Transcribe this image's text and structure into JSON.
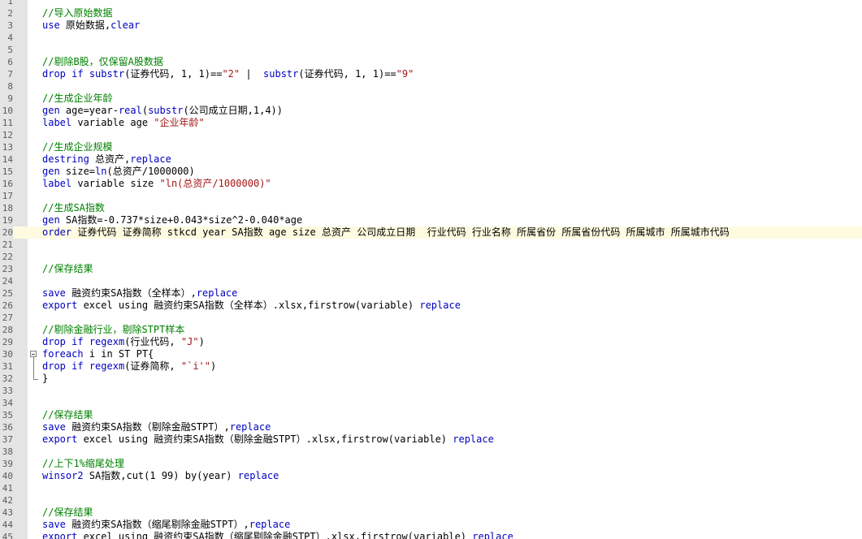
{
  "editor": {
    "colors": {
      "keyword": "#0000c0",
      "comment": "#008000",
      "string": "#a31515",
      "text": "#000000",
      "current_line": "#fffbe0"
    },
    "lines": [
      {
        "n": "1",
        "seg": []
      },
      {
        "n": "2",
        "seg": [
          {
            "c": "cm",
            "t": "//导入原始数据"
          }
        ]
      },
      {
        "n": "3",
        "seg": [
          {
            "c": "kw",
            "t": "use"
          },
          {
            "c": "",
            "t": " 原始数据,"
          },
          {
            "c": "kw",
            "t": "clear"
          }
        ]
      },
      {
        "n": "4",
        "seg": []
      },
      {
        "n": "5",
        "seg": []
      },
      {
        "n": "6",
        "seg": [
          {
            "c": "cm",
            "t": "//剔除B股，仅保留A股数据"
          }
        ]
      },
      {
        "n": "7",
        "seg": [
          {
            "c": "kw",
            "t": "drop"
          },
          {
            "c": "",
            "t": " "
          },
          {
            "c": "kw",
            "t": "if"
          },
          {
            "c": "",
            "t": " "
          },
          {
            "c": "fn",
            "t": "substr"
          },
          {
            "c": "",
            "t": "(证券代码, 1, 1)=="
          },
          {
            "c": "str",
            "t": "\"2\""
          },
          {
            "c": "",
            "t": " |  "
          },
          {
            "c": "fn",
            "t": "substr"
          },
          {
            "c": "",
            "t": "(证券代码, 1, 1)=="
          },
          {
            "c": "str",
            "t": "\"9\""
          }
        ]
      },
      {
        "n": "8",
        "seg": []
      },
      {
        "n": "9",
        "seg": [
          {
            "c": "cm",
            "t": "//生成企业年龄"
          }
        ]
      },
      {
        "n": "10",
        "seg": [
          {
            "c": "kw",
            "t": "gen"
          },
          {
            "c": "",
            "t": " age=year-"
          },
          {
            "c": "fn",
            "t": "real"
          },
          {
            "c": "",
            "t": "("
          },
          {
            "c": "fn",
            "t": "substr"
          },
          {
            "c": "",
            "t": "(公司成立日期,1,4))"
          }
        ]
      },
      {
        "n": "11",
        "seg": [
          {
            "c": "kw",
            "t": "label"
          },
          {
            "c": "",
            "t": " variable age "
          },
          {
            "c": "str",
            "t": "\"企业年龄\""
          }
        ]
      },
      {
        "n": "12",
        "seg": []
      },
      {
        "n": "13",
        "seg": [
          {
            "c": "cm",
            "t": "//生成企业规模"
          }
        ]
      },
      {
        "n": "14",
        "seg": [
          {
            "c": "kw",
            "t": "destring"
          },
          {
            "c": "",
            "t": " 总资产,"
          },
          {
            "c": "kw",
            "t": "replace"
          }
        ]
      },
      {
        "n": "15",
        "seg": [
          {
            "c": "kw",
            "t": "gen"
          },
          {
            "c": "",
            "t": " size="
          },
          {
            "c": "fn",
            "t": "ln"
          },
          {
            "c": "",
            "t": "(总资产/1000000)"
          }
        ]
      },
      {
        "n": "16",
        "seg": [
          {
            "c": "kw",
            "t": "label"
          },
          {
            "c": "",
            "t": " variable size "
          },
          {
            "c": "str",
            "t": "\"ln(总资产/1000000)\""
          }
        ]
      },
      {
        "n": "17",
        "seg": []
      },
      {
        "n": "18",
        "seg": [
          {
            "c": "cm",
            "t": "//生成SA指数"
          }
        ]
      },
      {
        "n": "19",
        "seg": [
          {
            "c": "kw",
            "t": "gen"
          },
          {
            "c": "",
            "t": " SA指数=-0.737*size+0.043*size^2-0.040*age"
          }
        ]
      },
      {
        "n": "20",
        "current": true,
        "seg": [
          {
            "c": "kw",
            "t": "order"
          },
          {
            "c": "",
            "t": " 证券代码 证券简称 stkcd year SA指数 age size 总资产 公司成立日期  行业代码 行业名称 所属省份 所属省份代码 所属城市 所属城市代码"
          }
        ]
      },
      {
        "n": "21",
        "seg": []
      },
      {
        "n": "22",
        "seg": []
      },
      {
        "n": "23",
        "seg": [
          {
            "c": "cm",
            "t": "//保存结果"
          }
        ]
      },
      {
        "n": "24",
        "seg": []
      },
      {
        "n": "25",
        "seg": [
          {
            "c": "kw",
            "t": "save"
          },
          {
            "c": "",
            "t": " 融资约束SA指数（全样本）,"
          },
          {
            "c": "kw",
            "t": "replace"
          }
        ]
      },
      {
        "n": "26",
        "seg": [
          {
            "c": "kw",
            "t": "export"
          },
          {
            "c": "",
            "t": " excel using 融资约束SA指数（全样本）.xlsx,firstrow(variable) "
          },
          {
            "c": "kw",
            "t": "replace"
          }
        ]
      },
      {
        "n": "27",
        "seg": []
      },
      {
        "n": "28",
        "seg": [
          {
            "c": "cm",
            "t": "//剔除金融行业，剔除STPT样本"
          }
        ]
      },
      {
        "n": "29",
        "seg": [
          {
            "c": "kw",
            "t": "drop"
          },
          {
            "c": "",
            "t": " "
          },
          {
            "c": "kw",
            "t": "if"
          },
          {
            "c": "",
            "t": " "
          },
          {
            "c": "fn",
            "t": "regexm"
          },
          {
            "c": "",
            "t": "(行业代码, "
          },
          {
            "c": "str",
            "t": "\"J\""
          },
          {
            "c": "",
            "t": ")"
          }
        ]
      },
      {
        "n": "30",
        "fold": "start",
        "seg": [
          {
            "c": "kw",
            "t": "foreach"
          },
          {
            "c": "",
            "t": " i in ST PT{"
          }
        ]
      },
      {
        "n": "31",
        "fold": "mid",
        "seg": [
          {
            "c": "kw",
            "t": "drop"
          },
          {
            "c": "",
            "t": " "
          },
          {
            "c": "kw",
            "t": "if"
          },
          {
            "c": "",
            "t": " "
          },
          {
            "c": "fn",
            "t": "regexm"
          },
          {
            "c": "",
            "t": "(证券简称, "
          },
          {
            "c": "str",
            "t": "\"`i'\""
          },
          {
            "c": "",
            "t": ")"
          }
        ]
      },
      {
        "n": "32",
        "fold": "end",
        "seg": [
          {
            "c": "",
            "t": "}"
          }
        ]
      },
      {
        "n": "33",
        "seg": []
      },
      {
        "n": "34",
        "seg": []
      },
      {
        "n": "35",
        "seg": [
          {
            "c": "cm",
            "t": "//保存结果"
          }
        ]
      },
      {
        "n": "36",
        "seg": [
          {
            "c": "kw",
            "t": "save"
          },
          {
            "c": "",
            "t": " 融资约束SA指数（剔除金融STPT）,"
          },
          {
            "c": "kw",
            "t": "replace"
          }
        ]
      },
      {
        "n": "37",
        "seg": [
          {
            "c": "kw",
            "t": "export"
          },
          {
            "c": "",
            "t": " excel using 融资约束SA指数（剔除金融STPT）.xlsx,firstrow(variable) "
          },
          {
            "c": "kw",
            "t": "replace"
          }
        ]
      },
      {
        "n": "38",
        "seg": []
      },
      {
        "n": "39",
        "seg": [
          {
            "c": "cm",
            "t": "//上下1%缩尾处理"
          }
        ]
      },
      {
        "n": "40",
        "seg": [
          {
            "c": "kw",
            "t": "winsor2"
          },
          {
            "c": "",
            "t": " SA指数,cut(1 99) by(year) "
          },
          {
            "c": "kw",
            "t": "replace"
          }
        ]
      },
      {
        "n": "41",
        "seg": []
      },
      {
        "n": "42",
        "seg": []
      },
      {
        "n": "43",
        "seg": [
          {
            "c": "cm",
            "t": "//保存结果"
          }
        ]
      },
      {
        "n": "44",
        "seg": [
          {
            "c": "kw",
            "t": "save"
          },
          {
            "c": "",
            "t": " 融资约束SA指数（缩尾剔除金融STPT）,"
          },
          {
            "c": "kw",
            "t": "replace"
          }
        ]
      },
      {
        "n": "45",
        "seg": [
          {
            "c": "kw",
            "t": "export"
          },
          {
            "c": "",
            "t": " excel using 融资约束SA指数（缩尾剔除金融STPT）.xlsx,firstrow(variable) "
          },
          {
            "c": "kw",
            "t": "replace"
          }
        ]
      }
    ]
  }
}
